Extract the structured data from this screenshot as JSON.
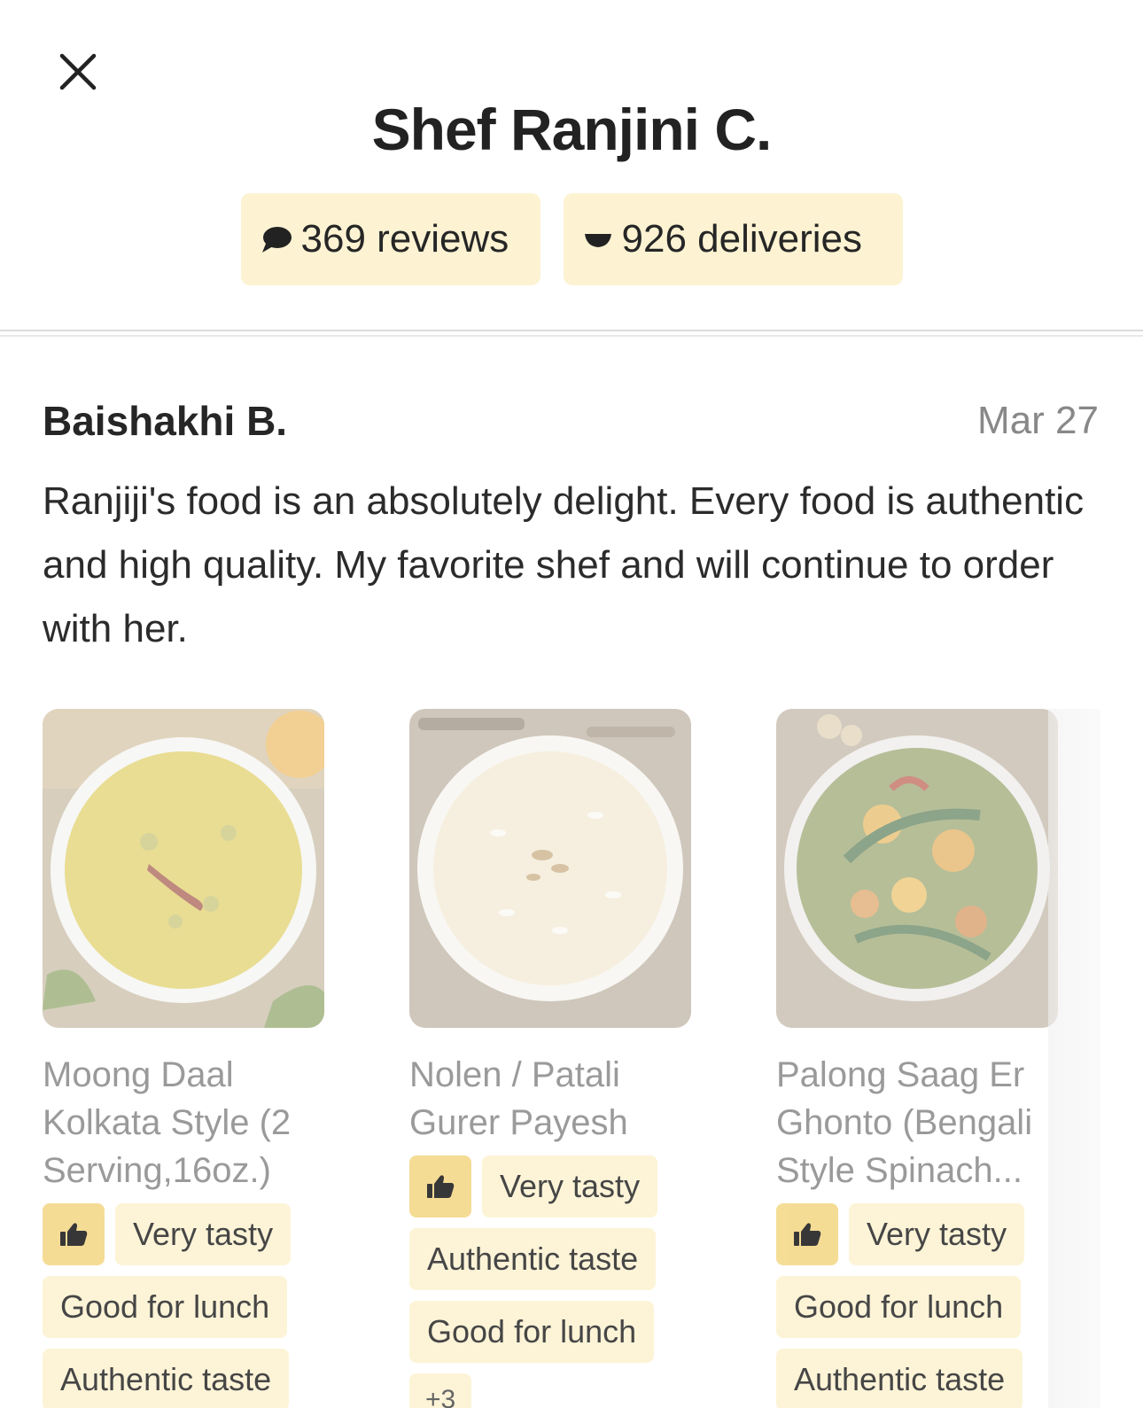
{
  "header": {
    "title": "Shef Ranjini C.",
    "reviews_label": "369 reviews",
    "deliveries_label": "926 deliveries"
  },
  "icons": {
    "close": "close-icon",
    "reviews": "speech-bubble-icon",
    "deliveries": "bowl-icon",
    "like": "thumbs-up-icon"
  },
  "review": {
    "author": "Baishakhi B.",
    "date": "Mar 27",
    "text": "Ranjiji's food is an absolutely delight. Every food is authentic and high quality. My favorite shef and will continue to order with her."
  },
  "dishes": [
    {
      "name": "Moong Daal Kolkata Style (2 Serving,16oz.)",
      "tags": [
        "Very tasty",
        "Good for lunch",
        "Authentic taste"
      ]
    },
    {
      "name": "Nolen / Patali Gurer Payesh",
      "tags": [
        "Very tasty",
        "Authentic taste",
        "Good for lunch"
      ],
      "more": "+3"
    },
    {
      "name": "Palong Saag Er Ghonto (Bengali Style Spinach...",
      "tags": [
        "Very tasty",
        "Good for lunch",
        "Authentic taste"
      ]
    }
  ],
  "colors": {
    "pill_bg": "#fdf3d3",
    "thumb_bg": "#f4d98a",
    "muted_text": "#9a9a9a"
  }
}
